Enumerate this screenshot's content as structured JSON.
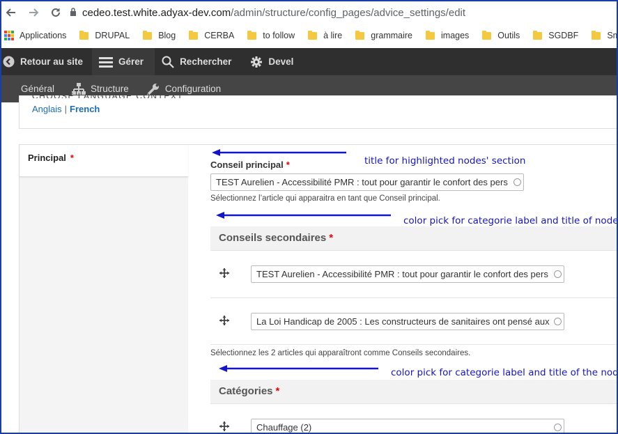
{
  "browser": {
    "url_host": "cedeo.test.white.adyax-dev.com",
    "url_path": "/admin/structure/config_pages/advice_settings/edit"
  },
  "bookmarks": {
    "apps_label": "Applications",
    "items": [
      "DRUPAL",
      "Blog",
      "CERBA",
      "to follow",
      "à lire",
      "grammaire",
      "images",
      "Outils",
      "SGDBF",
      "Smile"
    ]
  },
  "toolbar": {
    "back": "Retour au site",
    "manage": "Gérer",
    "search": "Rechercher",
    "devel": "Devel",
    "sub": {
      "general": "Général",
      "structure": "Structure",
      "configuration": "Configuration"
    }
  },
  "language": {
    "title": "CHOOSE LANGUAGE CONTEXT",
    "links": [
      "Anglais",
      "French"
    ],
    "separator": "|"
  },
  "vtab": {
    "label": "Principal",
    "required": "*"
  },
  "conseil_principal": {
    "label": "Conseil principal",
    "required": "*",
    "value": "TEST Aurelien - Accessibilité PMR : tout pour garantir le confort des pers",
    "description": "Sélectionnez l’article qui apparaitra en tant que Conseil principal."
  },
  "conseils_secondaires": {
    "title": "Conseils secondaires",
    "required": "*",
    "rows": [
      "TEST Aurelien - Accessibilité PMR : tout pour garantir le confort des pers",
      "La Loi Handicap de 2005 : Les constructeurs de sanitaires ont pensé aux"
    ],
    "description": "Sélectionnez les 2 articles qui apparaîtront comme Conseils secondaires."
  },
  "categories": {
    "title": "Catégories",
    "required": "*",
    "rows": [
      "Chauffage (2)"
    ]
  },
  "annotations": {
    "note1": "title for highlighted nodes' section",
    "note2": "color pick for categorie label and title of node",
    "note3": "color pick for categorie label and title of the node"
  }
}
